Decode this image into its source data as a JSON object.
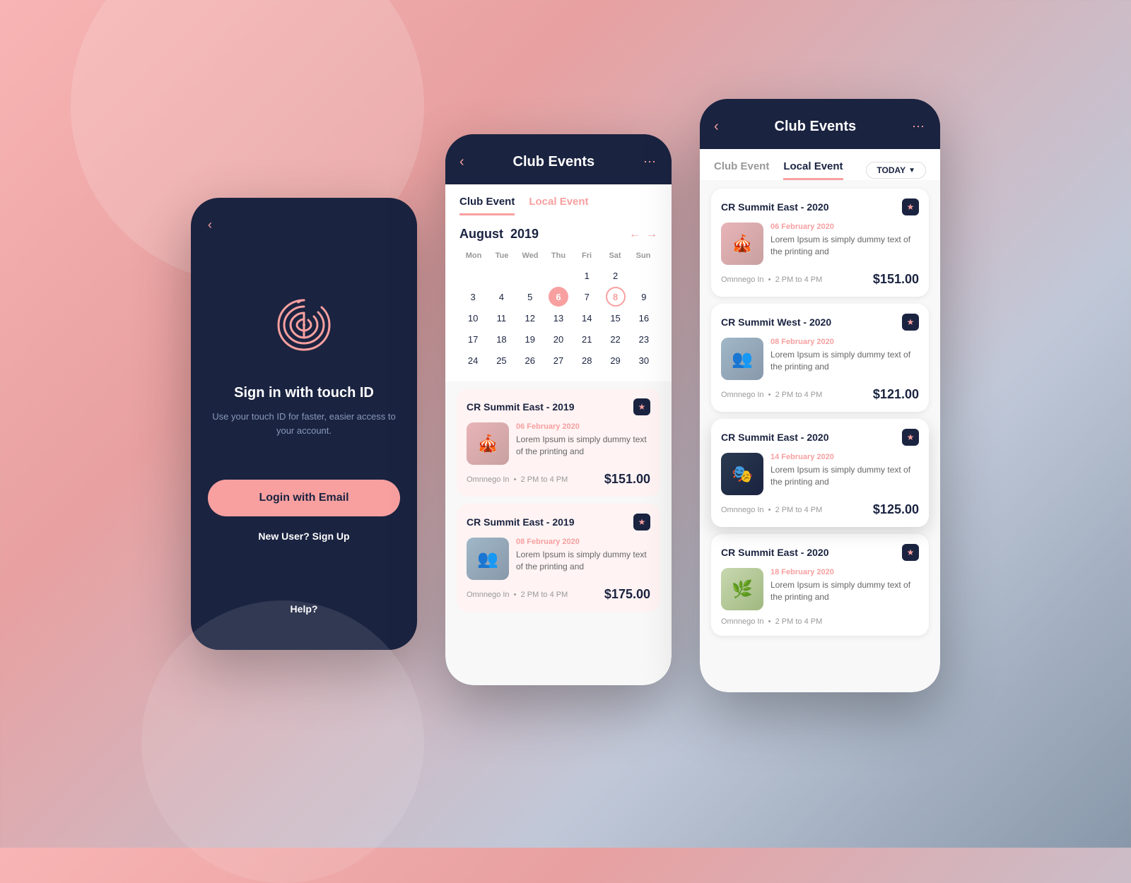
{
  "phone1": {
    "back_label": "‹",
    "title": "Sign in with touch ID",
    "subtitle": "Use your touch ID for faster, easier\naccess to your account.",
    "login_btn": "Login with Email",
    "signup_link": "New User? Sign Up",
    "help_link": "Help?"
  },
  "phone2": {
    "header": {
      "back": "‹",
      "title": "Club Events",
      "dots": "⋮⋮"
    },
    "tabs": [
      {
        "label": "Club Event",
        "active": true
      },
      {
        "label": "Local Event",
        "active": false
      }
    ],
    "calendar": {
      "month": "August",
      "year": "2019",
      "days_header": [
        "Mon",
        "Tue",
        "Wed",
        "Thu",
        "Fri",
        "Sat",
        "Sun"
      ],
      "highlighted_day": "6",
      "outlined_day": "8"
    },
    "events": [
      {
        "title": "CR Summit East - 2019",
        "date": "06 February 2020",
        "desc": "Lorem Ipsum is simply dummy text of the printing and",
        "location": "Omnnego In",
        "time": "2 PM to 4 PM",
        "price": "$151.00",
        "img_class": "img-people-1"
      },
      {
        "title": "CR Summit East - 2019",
        "date": "08 February 2020",
        "desc": "Lorem Ipsum is simply dummy text of the printing and",
        "location": "Omnnego In",
        "time": "2 PM to 4 PM",
        "price": "$175.00",
        "img_class": "img-people-2"
      }
    ]
  },
  "phone3": {
    "header": {
      "back": "‹",
      "title": "Club Events",
      "dots": "⋮⋮"
    },
    "tabs": [
      {
        "label": "Club Event",
        "active": false
      },
      {
        "label": "Local Event",
        "active": true
      }
    ],
    "today_btn": "TODAY",
    "events": [
      {
        "title": "CR Summit East - 2020",
        "date": "06 February 2020",
        "desc": "Lorem Ipsum is simply dummy text of the printing and",
        "location": "Omnnego In",
        "time": "2 PM to 4 PM",
        "price": "$151.00",
        "img_class": "img-people-1"
      },
      {
        "title": "CR Summit West - 2020",
        "date": "08 February 2020",
        "desc": "Lorem Ipsum is simply dummy text of the printing and",
        "location": "Omnnego In",
        "time": "2 PM to 4 PM",
        "price": "$121.00",
        "img_class": "img-people-2"
      },
      {
        "title": "CR Summit East - 2020",
        "date": "14 February 2020",
        "desc": "Lorem Ipsum is simply dummy text of the printing and",
        "location": "Omnnego In",
        "time": "2 PM to 4 PM",
        "price": "$125.00",
        "img_class": "img-people-3",
        "elevated": true
      },
      {
        "title": "CR Summit East - 2020",
        "date": "18 February 2020",
        "desc": "Lorem Ipsum is simply dummy text of the printing and",
        "location": "Omnnego In",
        "time": "2 PM to 4 PM",
        "price": null,
        "img_class": "img-people-4"
      }
    ]
  },
  "colors": {
    "accent": "#f8a0a0",
    "dark": "#1a2340",
    "light_pink": "#fff3f3"
  }
}
